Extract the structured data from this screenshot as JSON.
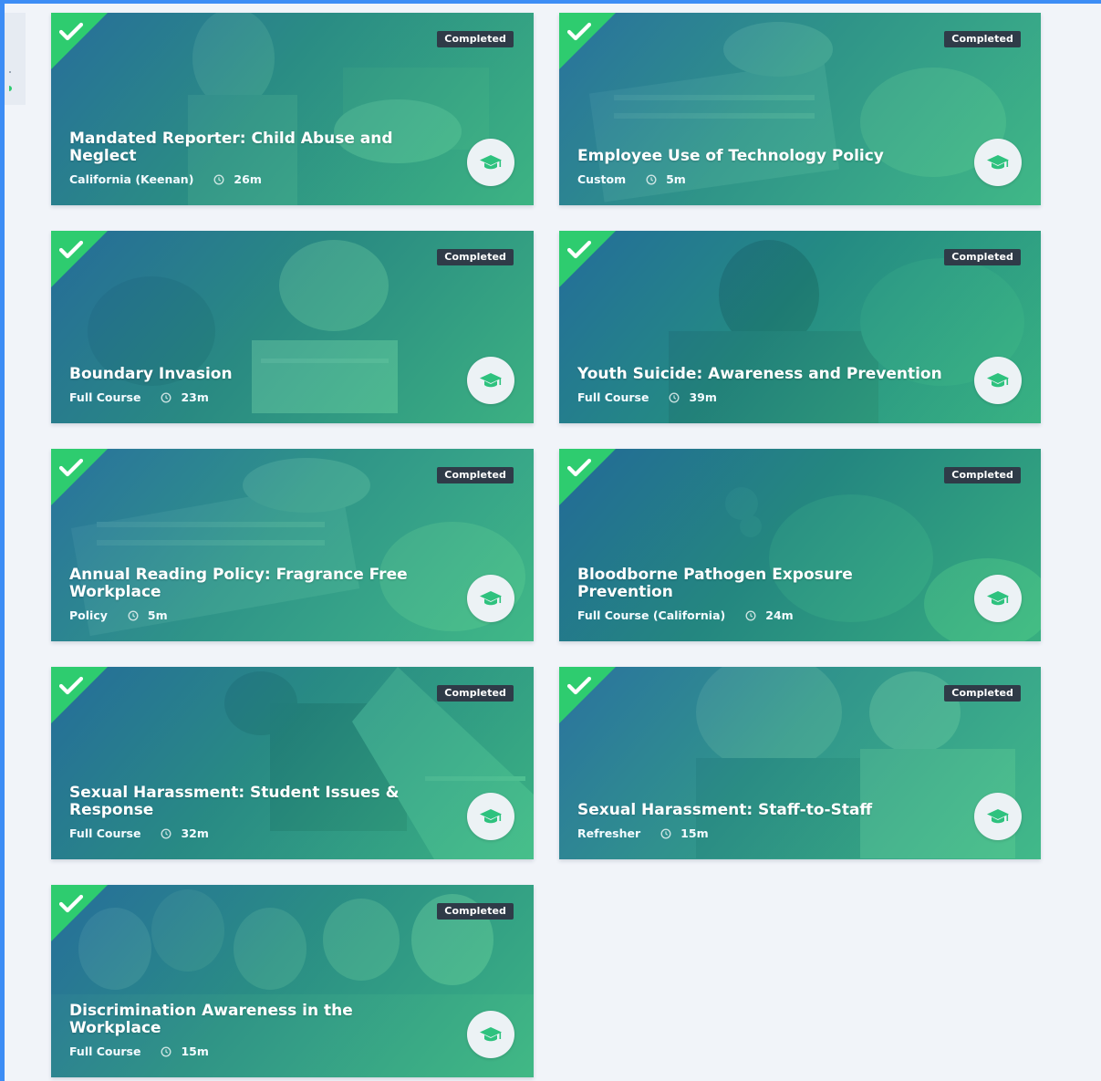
{
  "theme": {
    "accent_blue": "#3d8df5",
    "complete_green": "#2ecc6f",
    "badge_bg": "#2f3b48",
    "button_icon": "#2ec27e"
  },
  "icons": {
    "check": "check-icon",
    "clock": "clock-icon",
    "launch": "graduation-cap-icon"
  },
  "courses": [
    {
      "title": "Mandated Reporter: Child Abuse and Neglect",
      "type": "California (Keenan)",
      "duration": "26m",
      "status": "Completed"
    },
    {
      "title": "Employee Use of Technology Policy",
      "type": "Custom",
      "duration": "5m",
      "status": "Completed"
    },
    {
      "title": "Boundary Invasion",
      "type": "Full Course",
      "duration": "23m",
      "status": "Completed"
    },
    {
      "title": "Youth Suicide: Awareness and Prevention",
      "type": "Full Course",
      "duration": "39m",
      "status": "Completed"
    },
    {
      "title": "Annual Reading Policy: Fragrance Free Workplace",
      "type": "Policy",
      "duration": "5m",
      "status": "Completed"
    },
    {
      "title": "Bloodborne Pathogen Exposure Prevention",
      "type": "Full Course (California)",
      "duration": "24m",
      "status": "Completed"
    },
    {
      "title": "Sexual Harassment: Student Issues & Response",
      "type": "Full Course",
      "duration": "32m",
      "status": "Completed"
    },
    {
      "title": "Sexual Harassment: Staff-to-Staff",
      "type": "Refresher",
      "duration": "15m",
      "status": "Completed"
    },
    {
      "title": "Discrimination Awareness in the Workplace",
      "type": "Full Course",
      "duration": "15m",
      "status": "Completed"
    }
  ]
}
